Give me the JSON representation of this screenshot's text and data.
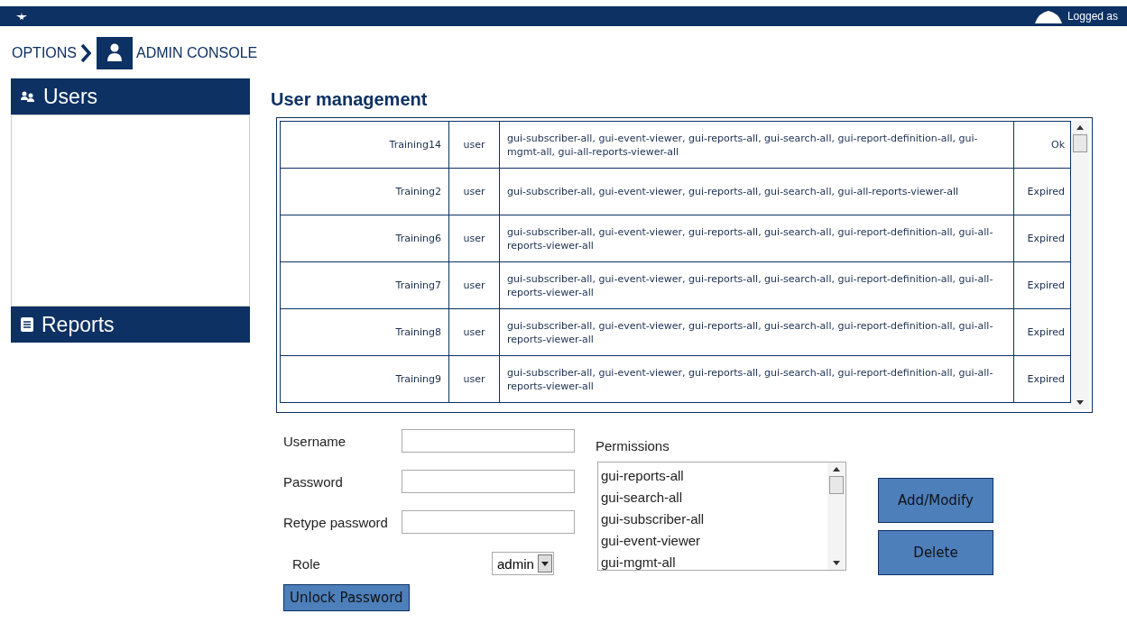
{
  "top_bar": {
    "user_text": "Logged as"
  },
  "breadcrumb": [
    {
      "label": "OPTIONS"
    },
    {
      "label": "ADMIN CONSOLE"
    }
  ],
  "sidebar": {
    "sections": [
      {
        "label": "Users"
      },
      {
        "label": "Reports"
      }
    ]
  },
  "title": "User management",
  "table": {
    "rows": [
      {
        "name": "Training14",
        "role": "user",
        "permissions": "gui-subscriber-all, gui-event-viewer, gui-reports-all, gui-search-all, gui-report-definition-all, gui-mgmt-all, gui-all-reports-viewer-all",
        "status": "Ok"
      },
      {
        "name": "Training2",
        "role": "user",
        "permissions": "gui-subscriber-all, gui-event-viewer, gui-reports-all, gui-search-all, gui-all-reports-viewer-all",
        "status": "Expired"
      },
      {
        "name": "Training6",
        "role": "user",
        "permissions": "gui-subscriber-all, gui-event-viewer, gui-reports-all, gui-search-all, gui-report-definition-all, gui-all-reports-viewer-all",
        "status": "Expired"
      },
      {
        "name": "Training7",
        "role": "user",
        "permissions": "gui-subscriber-all, gui-event-viewer, gui-reports-all, gui-search-all, gui-report-definition-all, gui-all-reports-viewer-all",
        "status": "Expired"
      },
      {
        "name": "Training8",
        "role": "user",
        "permissions": "gui-subscriber-all, gui-event-viewer, gui-reports-all, gui-search-all, gui-report-definition-all, gui-all-reports-viewer-all",
        "status": "Expired"
      },
      {
        "name": "Training9",
        "role": "user",
        "permissions": "gui-subscriber-all, gui-event-viewer, gui-reports-all, gui-search-all, gui-report-definition-all, gui-all-reports-viewer-all",
        "status": "Expired"
      }
    ]
  },
  "form": {
    "username_label": "Username",
    "password_label": "Password",
    "retype_label": "Retype password",
    "role_label": "Role",
    "role_value": "admin",
    "permissions_label": "Permissions",
    "permissions": [
      "gui-reports-all",
      "gui-search-all",
      "gui-subscriber-all",
      "gui-event-viewer",
      "gui-mgmt-all"
    ],
    "buttons": [
      "Add/Modify",
      "Delete"
    ],
    "unlock_button": "Unlock Password"
  }
}
